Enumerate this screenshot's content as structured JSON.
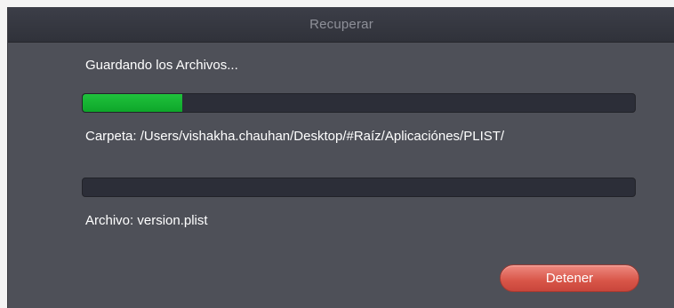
{
  "window": {
    "title": "Recuperar"
  },
  "status_text": "Guardando los Archivos...",
  "progress": {
    "overall_fraction": 0.18,
    "file_fraction": 0.0,
    "fill_color": "#13b030"
  },
  "folder_label": "Carpeta: /Users/vishakha.chauhan/Desktop/#Raíz/Aplicaciónes/PLIST/",
  "file_label": "Archivo: version.plist",
  "buttons": {
    "stop_label": "Detener"
  },
  "colors": {
    "dialog_bg": "#4e5058",
    "titlebar_bg": "#34363f",
    "track_bg": "#2c2e38",
    "stop_button": "#e06a5e"
  }
}
